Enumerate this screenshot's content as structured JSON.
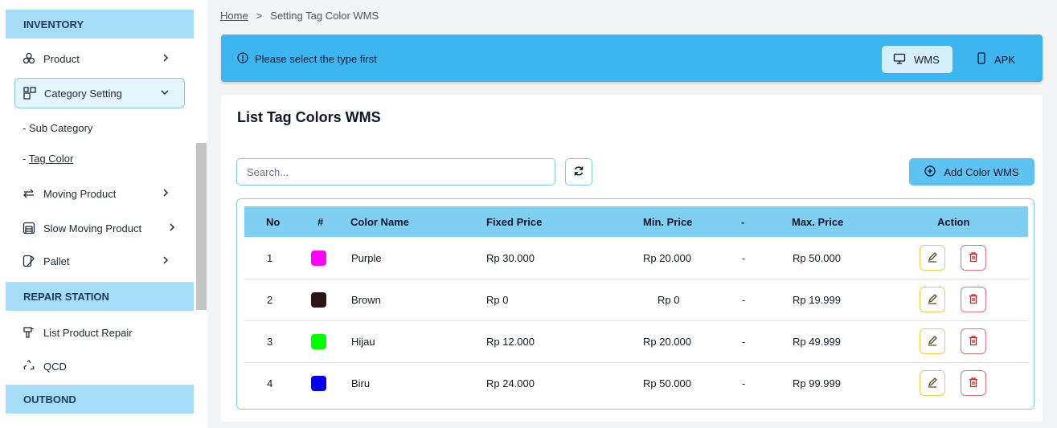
{
  "sidebar": {
    "sections": {
      "inventory": "INVENTORY",
      "repair": "REPAIR STATION",
      "outbond": "OUTBOND"
    },
    "items": {
      "product": "Product",
      "category_setting": "Category Setting",
      "sub_category": "- Sub Category",
      "tag_color": "Tag Color",
      "tag_color_prefix": "- ",
      "moving_product": "Moving Product",
      "slow_moving_product": "Slow Moving Product",
      "pallet": "Pallet",
      "list_product_repair": "List Product Repair",
      "qcd": "QCD"
    }
  },
  "breadcrumb": {
    "home": "Home",
    "separator": ">",
    "current": "Setting Tag Color WMS"
  },
  "banner": {
    "message": "Please select the type first",
    "wms_label": "WMS",
    "apk_label": "APK"
  },
  "card": {
    "title": "List Tag Colors WMS",
    "search_placeholder": "Search...",
    "add_button": "Add Color WMS"
  },
  "table": {
    "headers": {
      "no": "No",
      "hash": "#",
      "color_name": "Color Name",
      "fixed_price": "Fixed Price",
      "min_price": "Min. Price",
      "dash": "-",
      "max_price": "Max. Price",
      "action": "Action"
    },
    "rows": [
      {
        "no": "1",
        "color": "#ff00ff",
        "name": "Purple",
        "fixed": "Rp 30.000",
        "min": "Rp 20.000",
        "dash": "-",
        "max": "Rp 50.000"
      },
      {
        "no": "2",
        "color": "#2b1414",
        "name": "Brown",
        "fixed": "Rp 0",
        "min": "Rp 0",
        "dash": "-",
        "max": "Rp 19.999"
      },
      {
        "no": "3",
        "color": "#00ff00",
        "name": "Hijau",
        "fixed": "Rp 12.000",
        "min": "Rp 20.000",
        "dash": "-",
        "max": "Rp 49.999"
      },
      {
        "no": "4",
        "color": "#0000ee",
        "name": "Biru",
        "fixed": "Rp 24.000",
        "min": "Rp 50.000",
        "dash": "-",
        "max": "Rp 99.999"
      }
    ]
  },
  "colors": {
    "accent": "#3db5f0",
    "section_header": "#a5dcf7",
    "table_header": "#7fcff3",
    "edit_border": "#f2c94c",
    "delete_border": "#e57373"
  },
  "icons": {
    "product": "boxes-icon",
    "category_setting": "category-grid-icon",
    "moving_product": "arrows-icon",
    "slow_moving_product": "warehouse-icon",
    "pallet": "pallet-icon",
    "list_product_repair": "drill-icon",
    "qcd": "recycle-icon",
    "banner_info": "info-circle-icon",
    "wms": "monitor-icon",
    "apk": "phone-icon",
    "refresh": "refresh-icon",
    "add": "plus-circle-icon",
    "edit": "pencil-icon",
    "delete": "trash-icon"
  }
}
